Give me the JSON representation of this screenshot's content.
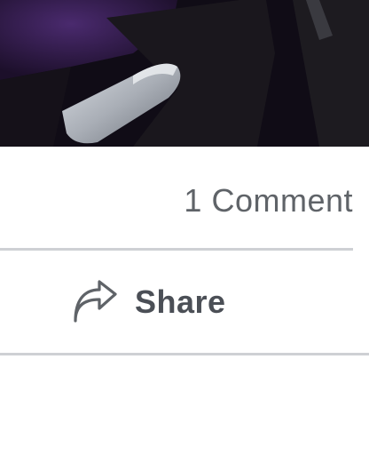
{
  "post": {
    "comment_count_label": "1 Comment"
  },
  "actions": {
    "share_label": "Share",
    "share_icon": "share-arrow-icon"
  },
  "colors": {
    "text_secondary": "#5f6368",
    "action_text": "#4b4f56",
    "divider": "#ced0d4"
  }
}
